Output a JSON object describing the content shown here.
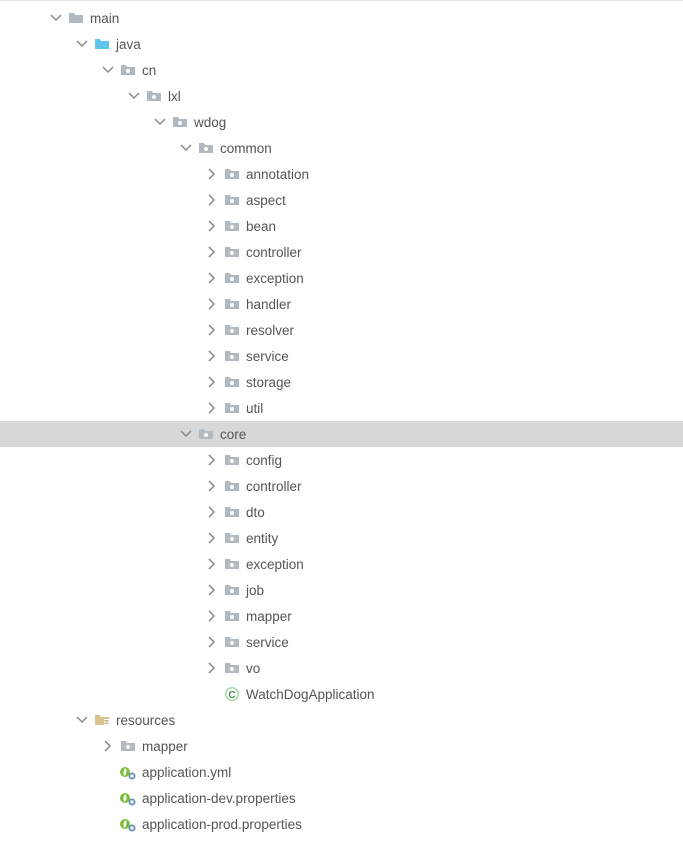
{
  "tree": {
    "main": "main",
    "java": "java",
    "cn": "cn",
    "lxl": "lxl",
    "wdog": "wdog",
    "common": "common",
    "common_children": {
      "annotation": "annotation",
      "aspect": "aspect",
      "bean": "bean",
      "controller": "controller",
      "exception": "exception",
      "handler": "handler",
      "resolver": "resolver",
      "service": "service",
      "storage": "storage",
      "util": "util"
    },
    "core": "core",
    "core_children": {
      "config": "config",
      "controller": "controller",
      "dto": "dto",
      "entity": "entity",
      "exception": "exception",
      "job": "job",
      "mapper": "mapper",
      "service": "service",
      "vo": "vo"
    },
    "app_class": "WatchDogApplication",
    "resources": "resources",
    "resources_children": {
      "mapper": "mapper",
      "application_yml": "application.yml",
      "application_dev": "application-dev.properties",
      "application_prod": "application-prod.properties"
    }
  },
  "colors": {
    "folder_gray": "#b0b9bf",
    "folder_blue": "#5fc5ea",
    "folder_res": "#d8c48a",
    "arrow": "#8a8a8a",
    "spring": "#7fbf3f"
  }
}
